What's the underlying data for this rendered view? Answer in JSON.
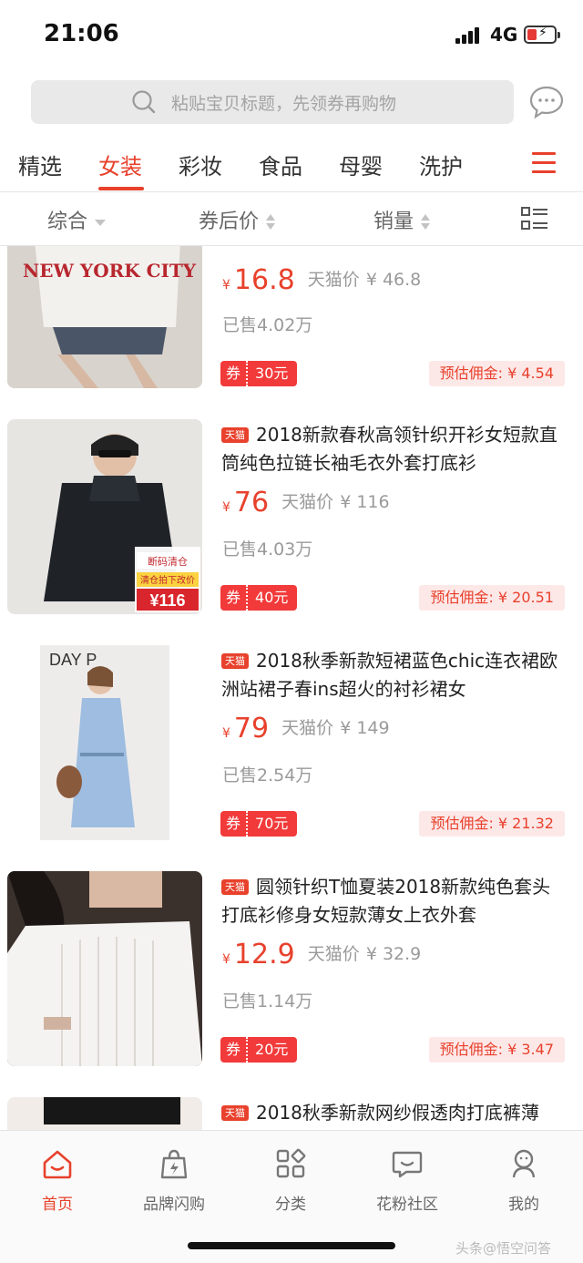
{
  "status_bar": {
    "time": "21:06",
    "network": "4G"
  },
  "search": {
    "placeholder": "粘贴宝贝标题，先领券再购物"
  },
  "tabs": [
    {
      "label": "精选"
    },
    {
      "label": "女装",
      "active": true
    },
    {
      "label": "彩妆"
    },
    {
      "label": "食品"
    },
    {
      "label": "母婴"
    },
    {
      "label": "洗护"
    }
  ],
  "sort": {
    "comprehensive": "综合",
    "after_coupon_price": "券后价",
    "sales": "销量"
  },
  "products": [
    {
      "title": "",
      "tmall": false,
      "image_text": "NEW YORK CITY",
      "price": "16.8",
      "tmall_price_label": "天猫价",
      "original_price": "¥ 46.8",
      "sold": "已售4.02万",
      "coupon_label": "券",
      "coupon_value": "30元",
      "commission": "预估佣金: ¥ 4.54"
    },
    {
      "title": "2018新款春秋高领针织开衫女短款直筒纯色拉链长袖毛衣外套打底衫",
      "tmall": true,
      "tmall_badge": "天猫",
      "image_tag1": "断码清仓",
      "image_tag2": "清仓拍下改价",
      "image_tag_price": "¥116",
      "price": "76",
      "tmall_price_label": "天猫价",
      "original_price": "¥ 116",
      "sold": "已售4.03万",
      "coupon_label": "券",
      "coupon_value": "40元",
      "commission": "预估佣金: ¥ 20.51"
    },
    {
      "title": "2018秋季新款短裙蓝色chic连衣裙欧洲站裙子春ins超火的衬衫裙女",
      "tmall": true,
      "tmall_badge": "天猫",
      "image_text": "DAY P",
      "price": "79",
      "tmall_price_label": "天猫价",
      "original_price": "¥ 149",
      "sold": "已售2.54万",
      "coupon_label": "券",
      "coupon_value": "70元",
      "commission": "预估佣金: ¥ 21.32"
    },
    {
      "title": "圆领针织T恤夏装2018新款纯色套头打底衫修身女短款薄女上衣外套",
      "tmall": true,
      "tmall_badge": "天猫",
      "price": "12.9",
      "tmall_price_label": "天猫价",
      "original_price": "¥ 32.9",
      "sold": "已售1.14万",
      "coupon_label": "券",
      "coupon_value": "20元",
      "commission": "预估佣金: ¥ 3.47"
    },
    {
      "title": "2018秋季新款网纱假透肉打底裤薄",
      "tmall": true,
      "tmall_badge": "天猫"
    }
  ],
  "currency_symbol": "¥",
  "bottom_nav": [
    {
      "label": "首页",
      "icon": "home-icon",
      "active": true
    },
    {
      "label": "品牌闪购",
      "icon": "flash-bag-icon"
    },
    {
      "label": "分类",
      "icon": "grid-icon"
    },
    {
      "label": "花粉社区",
      "icon": "community-icon"
    },
    {
      "label": "我的",
      "icon": "profile-icon"
    }
  ],
  "watermark": "头条@悟空问答",
  "colors": {
    "accent": "#e8412c",
    "coupon": "#f23a3a",
    "commission_bg": "#fde8e8"
  }
}
